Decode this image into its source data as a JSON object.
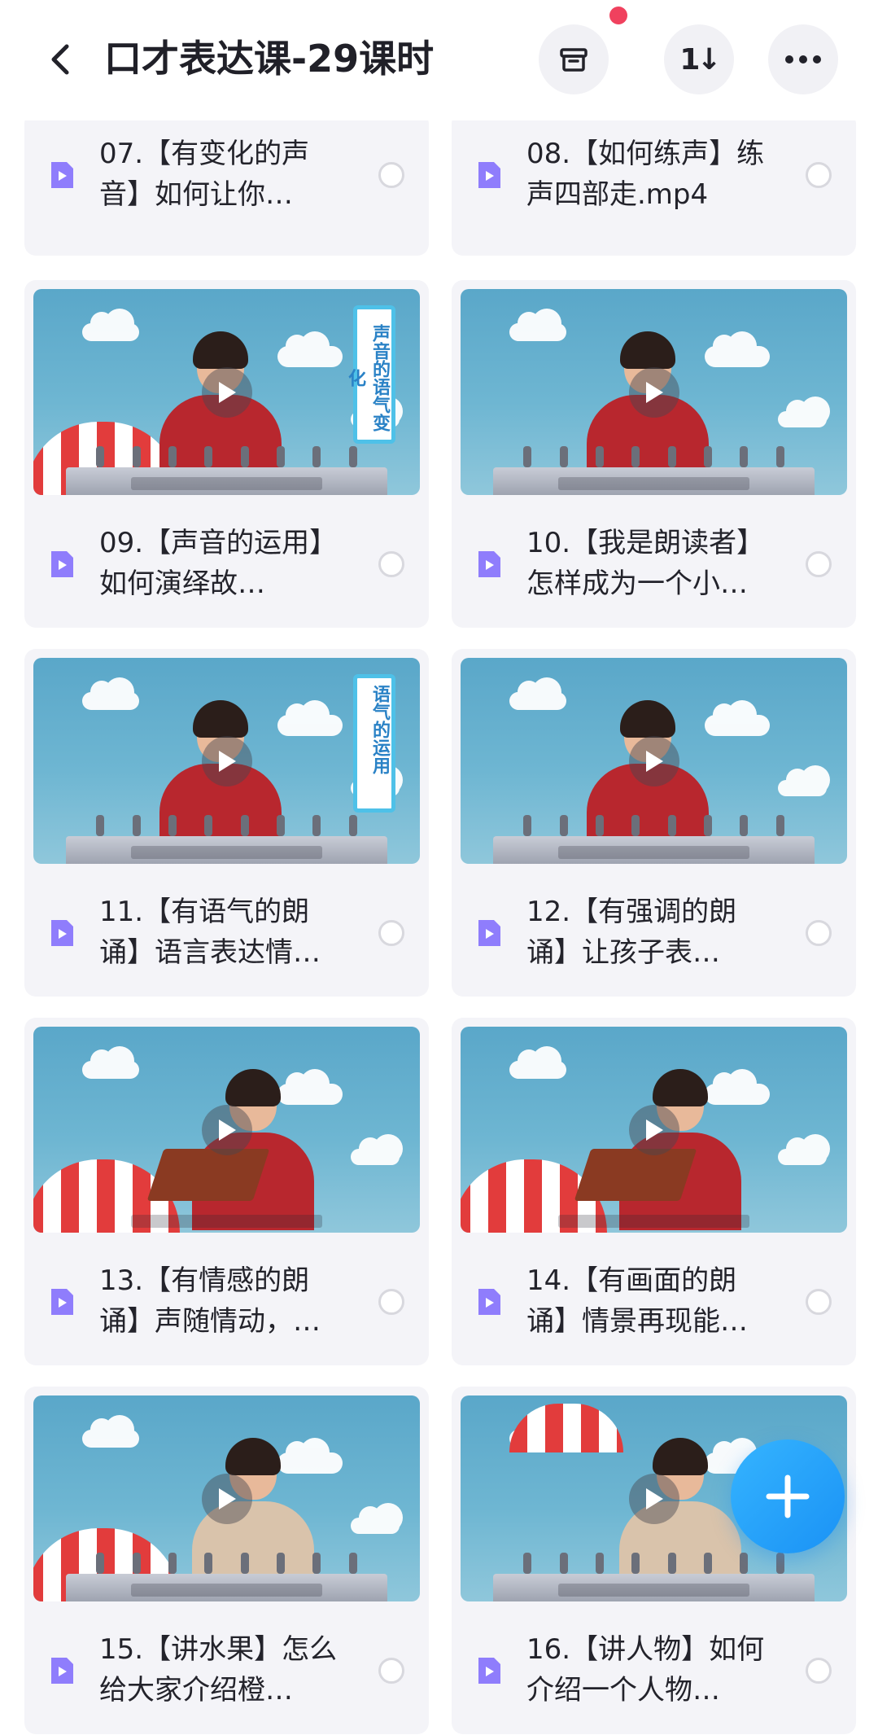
{
  "header": {
    "title": "口才表达课-29课时",
    "sort_label": "1↓"
  },
  "files": [
    {
      "name": "07.【有变化的声音】如何让你…",
      "has_thumb": false
    },
    {
      "name": "08.【如何练声】练声四部走.mp4",
      "has_thumb": false
    },
    {
      "name": "09.【声音的运用】如何演绎故…",
      "has_thumb": true,
      "scene": "sign",
      "sign_text": "声音的语气变化"
    },
    {
      "name": "10.【我是朗读者】怎样成为一个小…",
      "has_thumb": true,
      "scene": "plain"
    },
    {
      "name": "11.【有语气的朗诵】语言表达情…",
      "has_thumb": true,
      "scene": "sign",
      "sign_text": "语气的运用"
    },
    {
      "name": "12.【有强调的朗诵】让孩子表…",
      "has_thumb": true,
      "scene": "plain"
    },
    {
      "name": "13.【有情感的朗诵】声随情动，…",
      "has_thumb": true,
      "scene": "book"
    },
    {
      "name": "14.【有画面的朗诵】情景再现能…",
      "has_thumb": true,
      "scene": "book"
    },
    {
      "name": "15.【讲水果】怎么给大家介绍橙…",
      "has_thumb": true,
      "scene": "fruit"
    },
    {
      "name": "16.【讲人物】如何介绍一个人物…",
      "has_thumb": true,
      "scene": "person"
    }
  ],
  "colors": {
    "accent": "#1a92f5",
    "file_icon": "#8f7dfc",
    "card_bg": "#f4f4f8",
    "notif": "#f0415e"
  },
  "icons": {
    "back": "chevron-left-icon",
    "archive": "archive-box-icon",
    "sort": "sort-icon",
    "more": "more-horizontal-icon",
    "play": "play-icon",
    "file": "video-file-icon",
    "add": "plus-icon"
  }
}
